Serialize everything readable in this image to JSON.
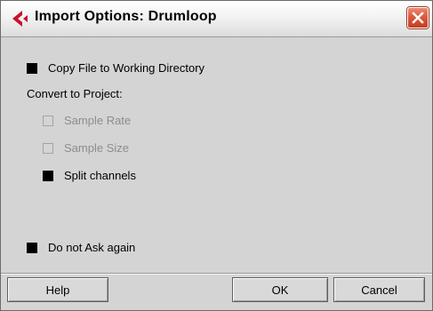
{
  "window": {
    "title": "Import Options: Drumloop"
  },
  "options": {
    "copy_file": {
      "label": "Copy File to Working Directory",
      "checked": true
    },
    "convert_heading": "Convert to Project:",
    "sample_rate": {
      "label": "Sample Rate",
      "checked": false,
      "enabled": false
    },
    "sample_size": {
      "label": "Sample Size",
      "checked": false,
      "enabled": false
    },
    "split_channels": {
      "label": "Split channels",
      "checked": true
    },
    "do_not_ask": {
      "label": "Do not Ask again",
      "checked": true
    }
  },
  "buttons": {
    "help": "Help",
    "ok": "OK",
    "cancel": "Cancel"
  },
  "icons": {
    "app": "cubase-logo-icon",
    "close": "close-icon"
  },
  "colors": {
    "logo_red": "#c8102e",
    "close_red": "#d9573a",
    "dialog_bg": "#d4d4d4"
  }
}
